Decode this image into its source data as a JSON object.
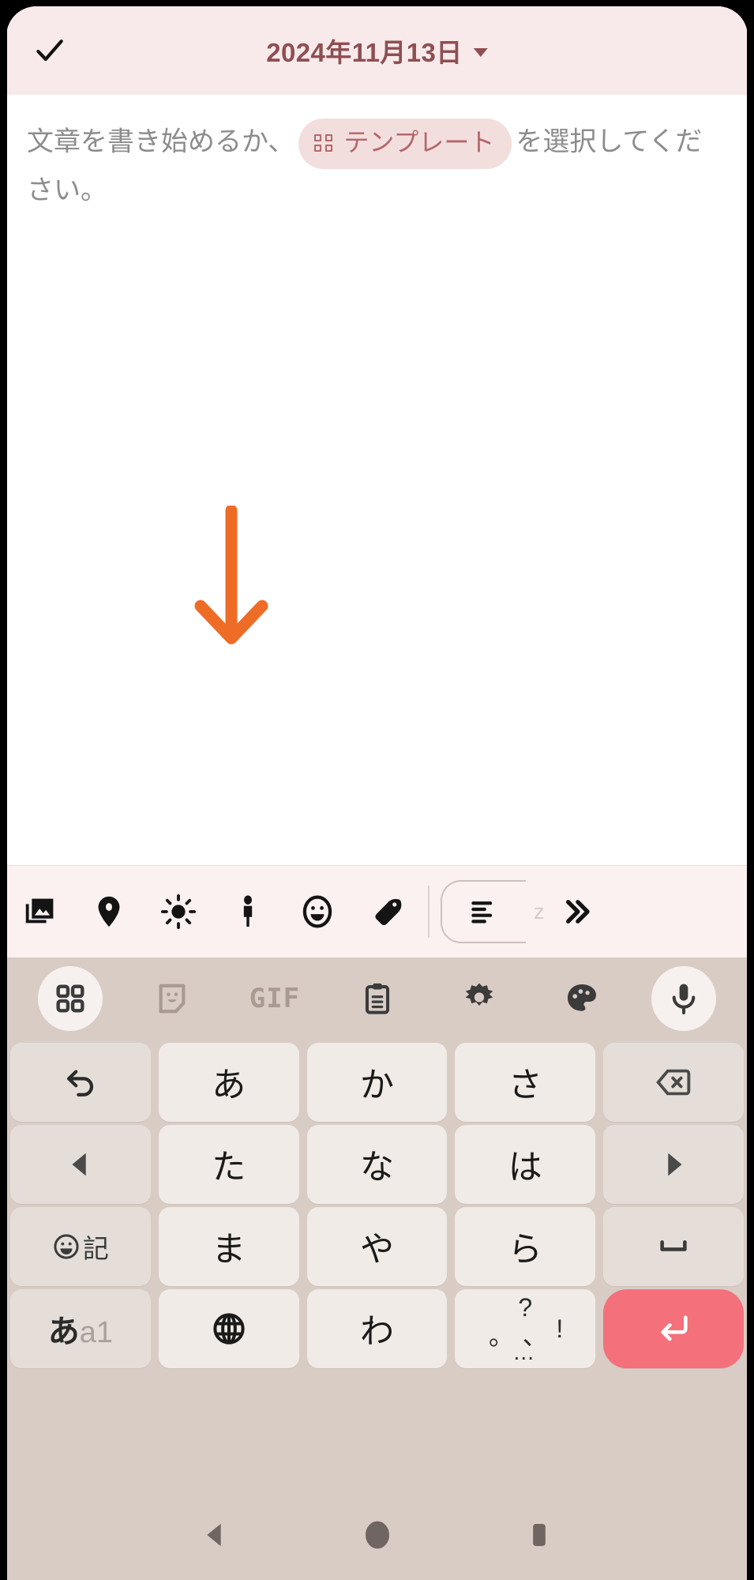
{
  "app": {
    "platform": "android",
    "theme_colors": {
      "header_bg": "#f8eaea",
      "header_text": "#8e4f52",
      "note_bg": "#ffffff",
      "placeholder_text": "#8c8c8c",
      "chip_bg": "#f3dede",
      "chip_text": "#b4676b",
      "format_toolbar_bg": "#faf1f0",
      "keyboard_bg": "#d9ccc5",
      "key_bg": "#f0ebe6",
      "key_fn_bg": "#e5ded8",
      "enter_key_bg": "#f4707a",
      "annotation_arrow": "#ef6c27",
      "navbar_bg": "#d9ccc5",
      "navbar_icon": "#6f6661"
    }
  },
  "header": {
    "confirm_icon": "check-icon",
    "date_title": "2024年11月13日",
    "dropdown_icon": "caret-down-icon"
  },
  "note": {
    "placeholder_prefix": "文章を書き始めるか、",
    "template_chip": {
      "icon": "grid-icon",
      "label": "テンプレート"
    },
    "placeholder_suffix": "を選択してください。"
  },
  "annotation": {
    "arrow_icon": "down-arrow-annotation",
    "color": "#ef6c27"
  },
  "format_toolbar": {
    "items": [
      {
        "name": "insert-image-button",
        "icon": "image-icon"
      },
      {
        "name": "insert-location-button",
        "icon": "location-pin-icon"
      },
      {
        "name": "insert-weather-button",
        "icon": "sun-icon"
      },
      {
        "name": "insert-person-button",
        "icon": "person-icon"
      },
      {
        "name": "insert-mood-button",
        "icon": "smiley-icon"
      },
      {
        "name": "insert-tag-button",
        "icon": "tag-icon"
      }
    ],
    "align_button": {
      "name": "text-align-button",
      "icon": "align-left-icon"
    },
    "ghost_label": "z",
    "expand_button": {
      "name": "expand-toolbar-button",
      "icon": "double-chevron-right-icon"
    }
  },
  "keyboard": {
    "toolbar": [
      {
        "name": "keyboard-apps-button",
        "icon": "grid-four-icon",
        "circled": true
      },
      {
        "name": "keyboard-sticker-button",
        "icon": "sticker-icon",
        "circled": false
      },
      {
        "name": "keyboard-gif-button",
        "icon": "gif-text",
        "label": "GIF",
        "circled": false
      },
      {
        "name": "keyboard-clipboard-button",
        "icon": "clipboard-icon",
        "circled": false
      },
      {
        "name": "keyboard-settings-button",
        "icon": "gear-icon",
        "circled": false
      },
      {
        "name": "keyboard-theme-button",
        "icon": "palette-icon",
        "circled": false
      },
      {
        "name": "keyboard-voice-button",
        "icon": "microphone-icon",
        "circled": true
      }
    ],
    "rows": [
      [
        {
          "name": "key-undo",
          "type": "fn",
          "icon": "undo-icon"
        },
        {
          "name": "key-a-row",
          "type": "kana",
          "label": "あ"
        },
        {
          "name": "key-ka-row",
          "type": "kana",
          "label": "か"
        },
        {
          "name": "key-sa-row",
          "type": "kana",
          "label": "さ"
        },
        {
          "name": "key-backspace",
          "type": "fn",
          "icon": "backspace-icon"
        }
      ],
      [
        {
          "name": "key-cursor-left",
          "type": "fn",
          "icon": "triangle-left-icon"
        },
        {
          "name": "key-ta-row",
          "type": "kana",
          "label": "た"
        },
        {
          "name": "key-na-row",
          "type": "kana",
          "label": "な"
        },
        {
          "name": "key-ha-row",
          "type": "kana",
          "label": "は"
        },
        {
          "name": "key-cursor-right",
          "type": "fn",
          "icon": "triangle-right-icon"
        }
      ],
      [
        {
          "name": "key-emoji-symbol",
          "type": "fn",
          "icon": "smiley-icon",
          "label": "記"
        },
        {
          "name": "key-ma-row",
          "type": "kana",
          "label": "ま"
        },
        {
          "name": "key-ya-row",
          "type": "kana",
          "label": "や"
        },
        {
          "name": "key-ra-row",
          "type": "kana",
          "label": "ら"
        },
        {
          "name": "key-space",
          "type": "fn",
          "icon": "space-icon"
        }
      ],
      [
        {
          "name": "key-input-mode",
          "type": "fn",
          "label_primary": "あ",
          "label_secondary": "a1"
        },
        {
          "name": "key-globe",
          "type": "kana",
          "icon": "globe-icon"
        },
        {
          "name": "key-wa-row",
          "type": "kana",
          "label": "わ"
        },
        {
          "name": "key-punctuation",
          "type": "kana",
          "marks": [
            "。",
            "、",
            "?",
            "!",
            "…"
          ]
        },
        {
          "name": "key-enter",
          "type": "enter",
          "icon": "enter-arrow-icon"
        }
      ]
    ]
  },
  "navbar": {
    "items": [
      {
        "name": "nav-back-button",
        "icon": "triangle-back-icon"
      },
      {
        "name": "nav-home-button",
        "icon": "circle-home-icon"
      },
      {
        "name": "nav-recents-button",
        "icon": "square-recents-icon"
      }
    ]
  }
}
